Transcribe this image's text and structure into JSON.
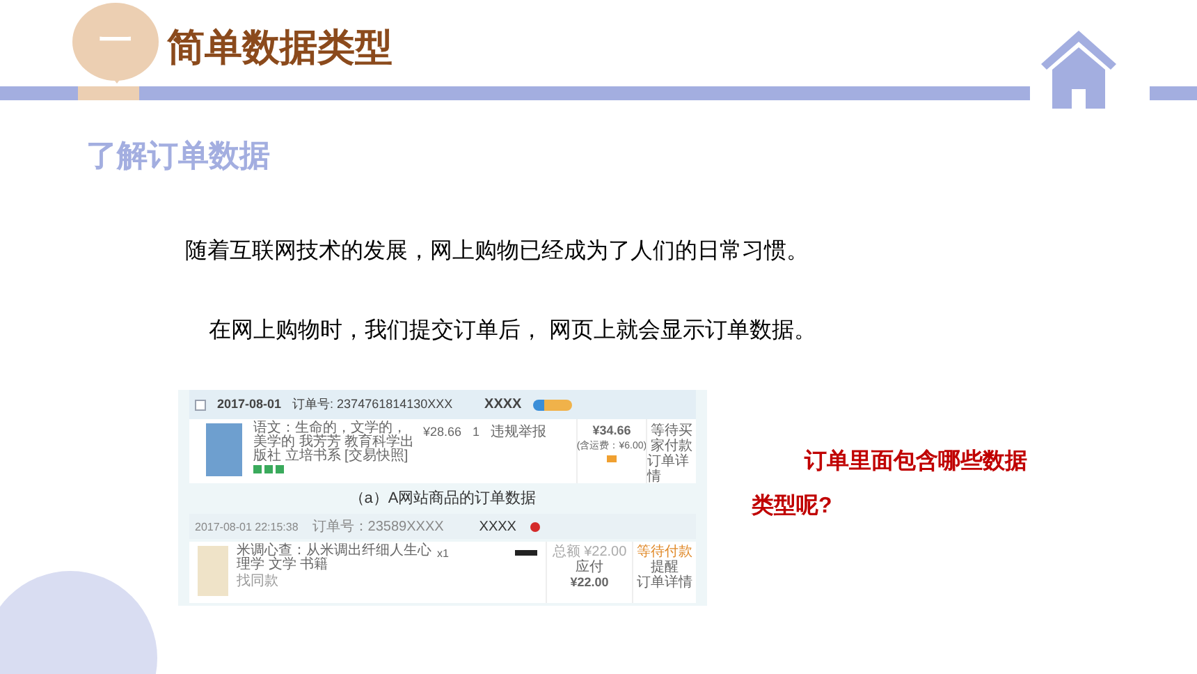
{
  "header": {
    "badge": "一",
    "title": "简单数据类型"
  },
  "section_title": "了解订单数据",
  "paragraphs": [
    "随着互联网技术的发展，网上购物已经成为了人们的日常习惯。",
    "在网上购物时，我们提交订单后， 网页上就会显示订单数据。"
  ],
  "question": [
    "订单里面包含哪些数据",
    "类型呢?"
  ],
  "order_screenshot": {
    "order_a": {
      "checked": false,
      "date": "2017-08-01",
      "order_no": "订单号: 2374761814130XXX",
      "seller": "XXXX",
      "item": "语文：生命的，文学的，美学的 我芳芳 教育科学出版社 立培书系 [交易快照]",
      "price": "¥28.66",
      "quantity": "1",
      "report": "违规举报",
      "total": "¥34.66",
      "shipping": "(含运费：¥6.00)",
      "status": "等待买家付款",
      "detail": "订单详情"
    },
    "caption": "（a）A网站商品的订单数据",
    "order_b": {
      "date": "2017-08-01 22:15:38",
      "order_no": "订单号：23589XXXX",
      "seller": "XXXX",
      "item": "米调心查：从米调出纤细人生心理学 文学 书籍",
      "extra": "找同款",
      "quantity": "x1",
      "total_label": "总额 ¥22.00",
      "pay_label": "应付",
      "total": "¥22.00",
      "status": "等待付款",
      "remind": "提醒",
      "detail": "订单详情"
    }
  }
}
